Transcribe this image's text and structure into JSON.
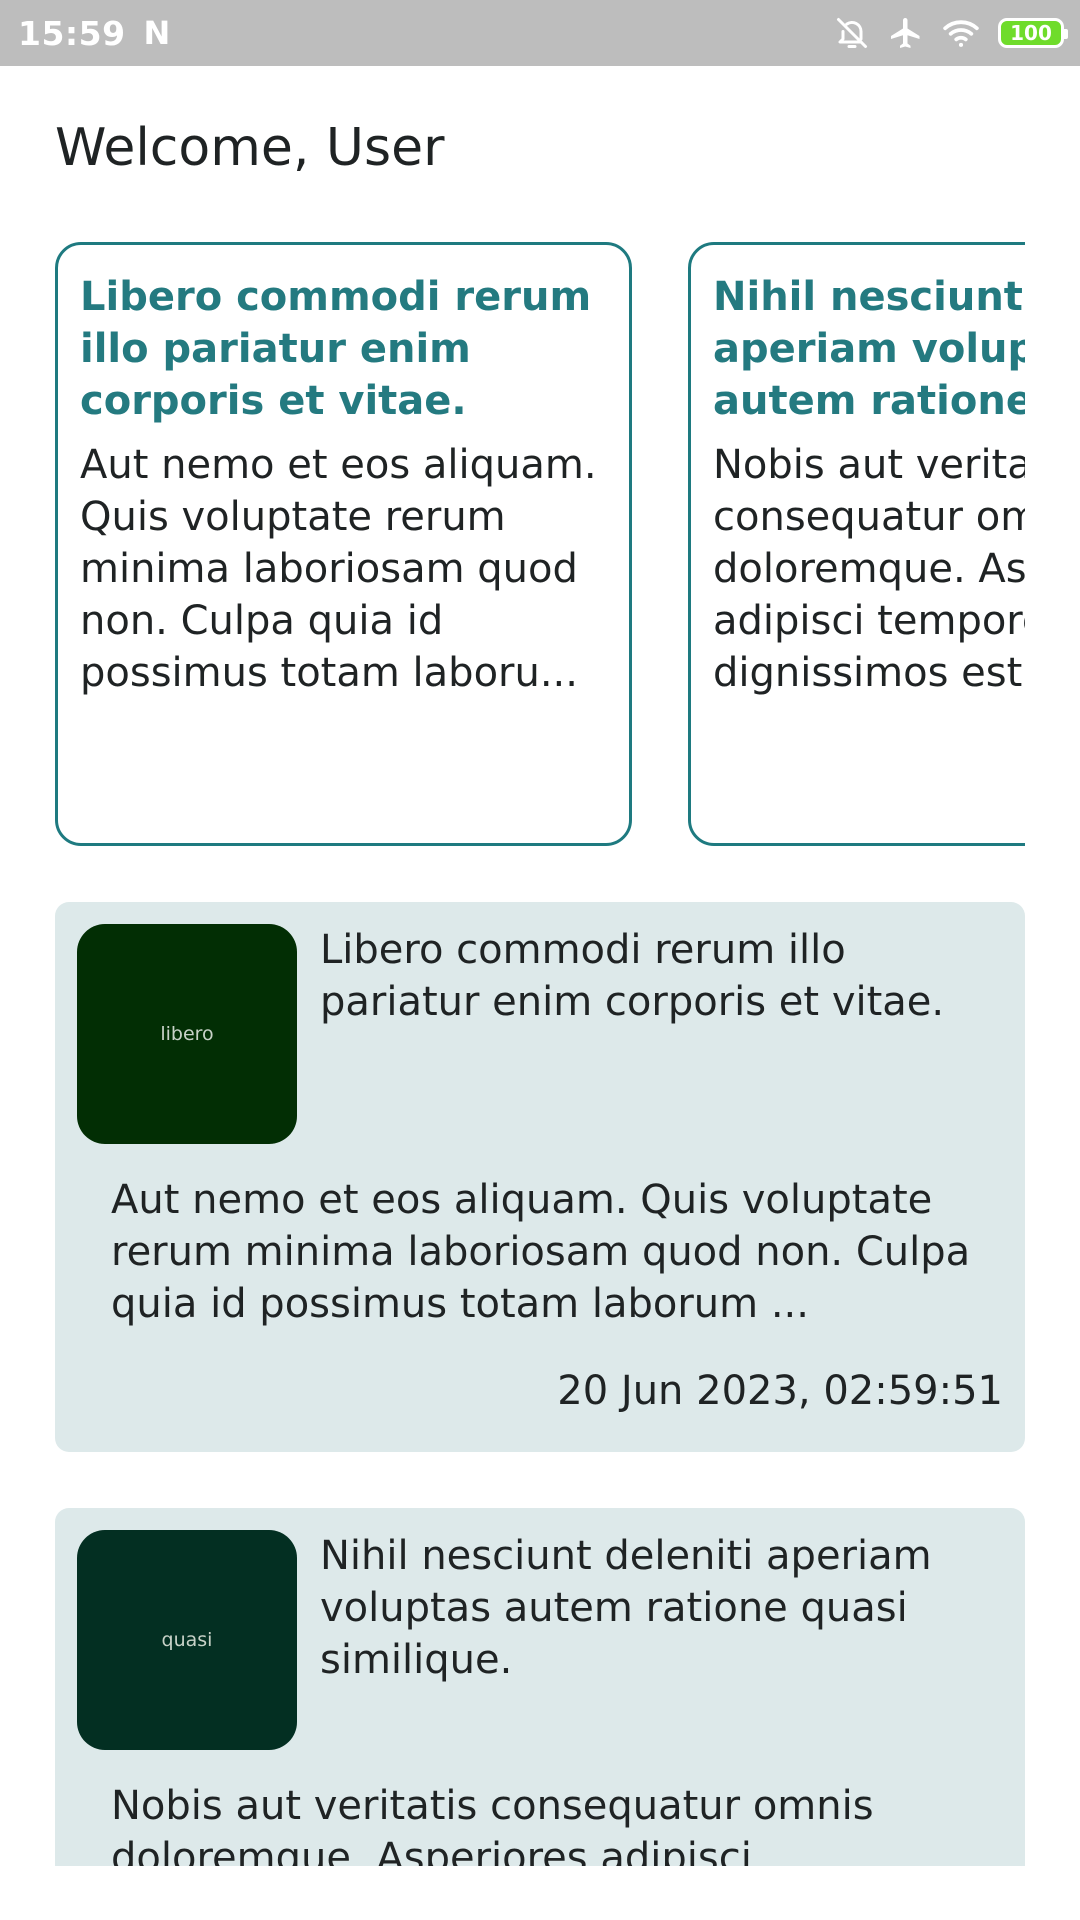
{
  "status_bar": {
    "time": "15:59",
    "notification_icon": "N",
    "icons": [
      "bell-off-icon",
      "airplane-icon",
      "wifi-icon"
    ],
    "battery": "100",
    "battery_color": "#6fdc2b"
  },
  "header": {
    "title": "Welcome, User"
  },
  "featured": [
    {
      "title": "Libero commodi rerum illo pariatur enim corporis et vitae.",
      "body": "Aut nemo et eos aliquam. Quis voluptate rerum minima laboriosam quod non. Culpa quia id possimus totam laboru..."
    },
    {
      "title": "Nihil nesciunt deleniti aperiam voluptas autem ratione quasi similique.",
      "body": "Nobis aut veritatis consequatur omnis doloremque. Asperiores adipisci tempore dignissimos est"
    }
  ],
  "list": [
    {
      "thumb_label": "libero",
      "thumb_color": "#022e04",
      "title": "Libero commodi rerum illo pariatur enim corporis et vitae.",
      "body": "Aut nemo et eos aliquam. Quis voluptate rerum minima laboriosam quod non. Culpa quia id possimus totam laborum ...",
      "date": "20 Jun 2023, 02:59:51"
    },
    {
      "thumb_label": "quasi",
      "thumb_color": "#032f22",
      "title": "Nihil nesciunt deleniti aperiam voluptas autem ratione quasi similique.",
      "body": "Nobis aut veritatis consequatur omnis doloremque. Asperiores adipisci"
    }
  ],
  "colors": {
    "accent": "#1e7a80",
    "card_bg": "#dde9ea",
    "status_bar_bg": "#bdbdbd"
  }
}
